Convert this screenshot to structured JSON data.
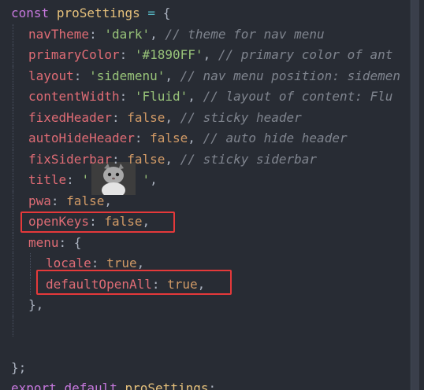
{
  "editor": {
    "lines": [
      {
        "tokens": [
          {
            "t": "const",
            "c": "kw"
          },
          {
            "t": " ",
            "c": "punc"
          },
          {
            "t": "proSettings",
            "c": "var"
          },
          {
            "t": " = ",
            "c": "op"
          },
          {
            "t": "{",
            "c": "punc"
          }
        ]
      },
      {
        "tokens": [
          {
            "t": "navTheme",
            "c": "prop"
          },
          {
            "t": ": ",
            "c": "punc"
          },
          {
            "t": "'dark'",
            "c": "str"
          },
          {
            "t": ", ",
            "c": "punc"
          },
          {
            "t": "// theme for nav menu",
            "c": "cm"
          }
        ]
      },
      {
        "tokens": [
          {
            "t": "primaryColor",
            "c": "prop"
          },
          {
            "t": ": ",
            "c": "punc"
          },
          {
            "t": "'#1890FF'",
            "c": "str"
          },
          {
            "t": ", ",
            "c": "punc"
          },
          {
            "t": "// primary color of ant",
            "c": "cm"
          }
        ]
      },
      {
        "tokens": [
          {
            "t": "layout",
            "c": "prop"
          },
          {
            "t": ": ",
            "c": "punc"
          },
          {
            "t": "'sidemenu'",
            "c": "str"
          },
          {
            "t": ", ",
            "c": "punc"
          },
          {
            "t": "// nav menu position: sidemen",
            "c": "cm"
          }
        ]
      },
      {
        "tokens": [
          {
            "t": "contentWidth",
            "c": "prop"
          },
          {
            "t": ": ",
            "c": "punc"
          },
          {
            "t": "'Fluid'",
            "c": "str"
          },
          {
            "t": ", ",
            "c": "punc"
          },
          {
            "t": "// layout of content: Flu",
            "c": "cm"
          }
        ]
      },
      {
        "tokens": [
          {
            "t": "fixedHeader",
            "c": "prop"
          },
          {
            "t": ": ",
            "c": "punc"
          },
          {
            "t": "false",
            "c": "bool"
          },
          {
            "t": ", ",
            "c": "punc"
          },
          {
            "t": "// sticky header",
            "c": "cm"
          }
        ]
      },
      {
        "tokens": [
          {
            "t": "autoHideHeader",
            "c": "prop"
          },
          {
            "t": ": ",
            "c": "punc"
          },
          {
            "t": "false",
            "c": "bool"
          },
          {
            "t": ", ",
            "c": "punc"
          },
          {
            "t": "// auto hide header",
            "c": "cm"
          }
        ]
      },
      {
        "tokens": [
          {
            "t": "fixSiderbar",
            "c": "prop"
          },
          {
            "t": ": ",
            "c": "punc"
          },
          {
            "t": "false",
            "c": "bool"
          },
          {
            "t": ", ",
            "c": "punc"
          },
          {
            "t": "// sticky siderbar",
            "c": "cm"
          }
        ]
      },
      {
        "tokens": [
          {
            "t": "title",
            "c": "prop"
          },
          {
            "t": ": ",
            "c": "punc"
          },
          {
            "t": "'       '",
            "c": "str"
          },
          {
            "t": ",",
            "c": "punc"
          }
        ]
      },
      {
        "tokens": [
          {
            "t": "pwa",
            "c": "prop"
          },
          {
            "t": ": ",
            "c": "punc"
          },
          {
            "t": "false",
            "c": "bool"
          },
          {
            "t": ",",
            "c": "punc"
          }
        ]
      },
      {
        "tokens": [
          {
            "t": "openKeys",
            "c": "prop"
          },
          {
            "t": ": ",
            "c": "punc"
          },
          {
            "t": "false",
            "c": "bool"
          },
          {
            "t": ",",
            "c": "punc"
          }
        ]
      },
      {
        "tokens": [
          {
            "t": "menu",
            "c": "prop"
          },
          {
            "t": ": ",
            "c": "punc"
          },
          {
            "t": "{",
            "c": "punc"
          }
        ]
      },
      {
        "tokens": [
          {
            "t": "locale",
            "c": "prop"
          },
          {
            "t": ": ",
            "c": "punc"
          },
          {
            "t": "true",
            "c": "bool"
          },
          {
            "t": ",",
            "c": "punc"
          }
        ]
      },
      {
        "tokens": [
          {
            "t": "defaultOpenAll",
            "c": "prop"
          },
          {
            "t": ": ",
            "c": "punc"
          },
          {
            "t": "true",
            "c": "bool"
          },
          {
            "t": ",",
            "c": "punc"
          }
        ]
      },
      {
        "tokens": [
          {
            "t": "},",
            "c": "punc"
          }
        ]
      },
      {
        "tokens": []
      },
      {
        "tokens": []
      },
      {
        "tokens": [
          {
            "t": "};",
            "c": "punc"
          }
        ]
      },
      {
        "tokens": [
          {
            "t": "export",
            "c": "kw"
          },
          {
            "t": " ",
            "c": "punc"
          },
          {
            "t": "default",
            "c": "kw"
          },
          {
            "t": " ",
            "c": "punc"
          },
          {
            "t": "proSettings",
            "c": "var"
          },
          {
            "t": ";",
            "c": "punc"
          }
        ]
      }
    ]
  },
  "colors": {
    "background": "#282c34",
    "keyword": "#c678dd",
    "property": "#e06c75",
    "string": "#98c379",
    "boolean": "#d19a66",
    "comment": "#7f848e",
    "highlight_box": "#e5393a"
  },
  "icons": {
    "avatar": "cat-avatar-image"
  }
}
